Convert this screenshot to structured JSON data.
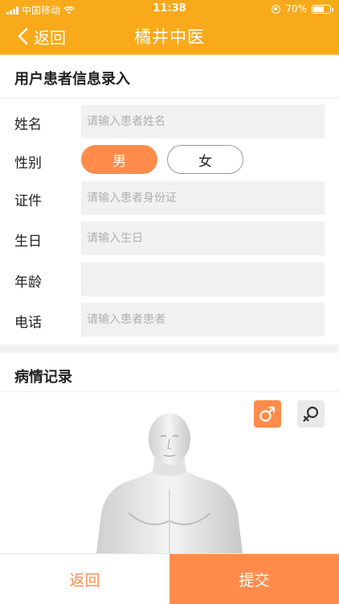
{
  "status_bar": {
    "carrier": "中国移动",
    "time": "11:38",
    "battery_text": "70%",
    "battery_level": 0.7
  },
  "nav": {
    "back_label": "返回",
    "title": "橘井中医"
  },
  "patient_section": {
    "title": "用户患者信息录入",
    "fields": {
      "name": {
        "label": "姓名",
        "placeholder": "请输入患者姓名",
        "value": ""
      },
      "gender": {
        "label": "性别",
        "options": [
          "男",
          "女"
        ],
        "selected": "男"
      },
      "id_card": {
        "label": "证件",
        "placeholder": "请输入患者身份证",
        "value": ""
      },
      "birthday": {
        "label": "生日",
        "placeholder": "请输入生日",
        "value": ""
      },
      "age": {
        "label": "年龄",
        "placeholder": "",
        "value": ""
      },
      "phone": {
        "label": "电话",
        "placeholder": "请输入患者患者",
        "value": ""
      }
    }
  },
  "record_section": {
    "title": "病情记录",
    "model_selected": "male",
    "icons": {
      "male": "male-symbol-icon",
      "female": "female-symbol-icon"
    }
  },
  "footer": {
    "back_label": "返回",
    "submit_label": "提交"
  },
  "colors": {
    "header": "#F8AA1A",
    "accent": "#FF8C4A"
  }
}
